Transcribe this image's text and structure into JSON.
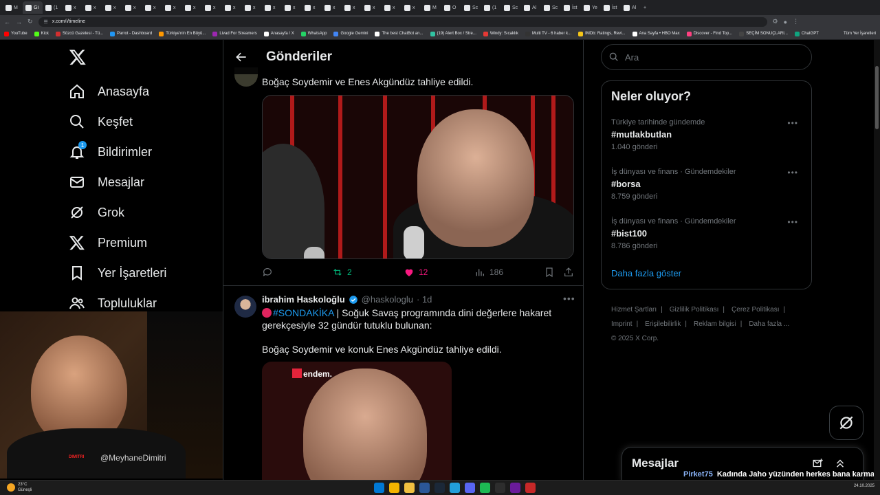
{
  "browser": {
    "tabs": [
      "M",
      "Gi",
      "(1",
      "x",
      "x",
      "x",
      "x",
      "x",
      "x",
      "x",
      "x",
      "x",
      "x",
      "x",
      "x",
      "x",
      "x",
      "x",
      "x",
      "x",
      "x",
      "M",
      "O",
      "Sc",
      "(1",
      "Sc",
      "Al",
      "Sc",
      "İst",
      "Ye",
      "İst",
      "Al"
    ],
    "url": "x.com/i/timeline",
    "bookmarks": [
      {
        "label": "YouTube",
        "color": "#ff0000"
      },
      {
        "label": "Kick",
        "color": "#53fc18"
      },
      {
        "label": "Sözcü Gazetesi - Tü...",
        "color": "#d32f2f"
      },
      {
        "label": "Parrot - Dashboard",
        "color": "#2196f3"
      },
      {
        "label": "Türkiye'nin En Büyü...",
        "color": "#ff9800"
      },
      {
        "label": "Livad For Streamers",
        "color": "#9c27b0"
      },
      {
        "label": "Anasayfa / X",
        "color": "#ffffff"
      },
      {
        "label": "WhatsApp",
        "color": "#25d366"
      },
      {
        "label": "Google Gemini",
        "color": "#4285f4"
      },
      {
        "label": "The best ChatBot an...",
        "color": "#ffffff"
      },
      {
        "label": "(19) Alert Box / Stre...",
        "color": "#31c3a2"
      },
      {
        "label": "Windy: Sıcaklık",
        "color": "#e53935"
      },
      {
        "label": "Multi TV - 6 haber k...",
        "color": "#333333"
      },
      {
        "label": "IMDb: Ratings, Revi...",
        "color": "#f5c518"
      },
      {
        "label": "Ana Sayfa • HBO Max",
        "color": "#ffffff"
      },
      {
        "label": "Discover - Find Top...",
        "color": "#ff4081"
      },
      {
        "label": "SEÇİM SONUÇLARI...",
        "color": "#444444"
      },
      {
        "label": "ChatGPT",
        "color": "#10a37f"
      }
    ],
    "bookmarks_more": "Tüm Yer İşaretleri"
  },
  "nav": {
    "items": [
      {
        "label": "Anasayfa",
        "icon": "home-icon"
      },
      {
        "label": "Keşfet",
        "icon": "search-icon"
      },
      {
        "label": "Bildirimler",
        "icon": "bell-icon",
        "badge": "1"
      },
      {
        "label": "Mesajlar",
        "icon": "mail-icon"
      },
      {
        "label": "Grok",
        "icon": "grok-icon"
      },
      {
        "label": "Premium",
        "icon": "x-icon"
      },
      {
        "label": "Yer İşaretleri",
        "icon": "bookmark-icon"
      },
      {
        "label": "Topluluklar",
        "icon": "people-icon"
      }
    ]
  },
  "webcam": {
    "handle": "@MeyhaneDimitri",
    "logo": "DIMITRI"
  },
  "main": {
    "title": "Gönderiler",
    "tweet1": {
      "text": "Boğaç Soydemir ve Enes Akgündüz tahliye edildi.",
      "retweets": "2",
      "likes": "12",
      "views": "186"
    },
    "tweet2": {
      "name": "ibrahim Haskoloğlu",
      "handle": "@haskologlu",
      "time": "· 1d",
      "hashtag": "#SONDAKİKA",
      "text_a": " | Soğuk Savaş programında dini değerlere hakaret gerekçesiyle 32 gündür tutuklu bulunan:",
      "text_b": "Boğaç Soydemir ve konuk Enes Akgündüz tahliye edildi.",
      "media_label": "endem."
    }
  },
  "search": {
    "placeholder": "Ara"
  },
  "trends": {
    "title": "Neler oluyor?",
    "items": [
      {
        "context": "Türkiye tarihinde gündemde",
        "tag": "#mutlakbutlan",
        "count": "1.040 gönderi"
      },
      {
        "context": "İş dünyası ve finans · Gündemdekiler",
        "tag": "#borsa",
        "count": "8.759 gönderi"
      },
      {
        "context": "İş dünyası ve finans · Gündemdekiler",
        "tag": "#bist100",
        "count": "8.786 gönderi"
      }
    ],
    "show_more": "Daha fazla göster"
  },
  "footer": {
    "links": [
      "Hizmet Şartları",
      "Gizlilik Politikası",
      "Çerez Politikası",
      "Imprint",
      "Erişilebilirlik",
      "Reklam bilgisi",
      "Daha fazla ..."
    ],
    "copyright": "© 2025 X Corp."
  },
  "messages": {
    "title": "Mesajlar"
  },
  "chat": {
    "user": "Pirket75",
    "message": "Kadında Jaho yüzünden herkes bana karma spamlıyor jahoyu asla affetmeyeceğim vs dedi"
  },
  "taskbar": {
    "temp": "23°C",
    "weather": "Güneşli",
    "date": "24.10.2025"
  }
}
